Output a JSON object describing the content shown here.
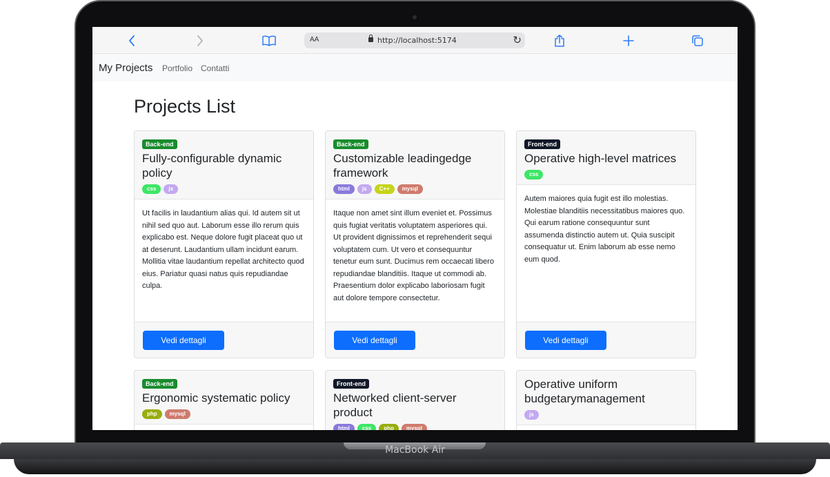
{
  "device": {
    "label": "MacBook Air"
  },
  "browser": {
    "text_size_label": "AA",
    "url": "http://localhost:5174"
  },
  "navbar": {
    "brand": "My Projects",
    "links": [
      "Portfolio",
      "Contatti"
    ]
  },
  "page": {
    "title": "Projects List"
  },
  "colors": {
    "backend_badge": "#198c2e",
    "frontend_badge": "#111827",
    "button": "#0d6efd",
    "tag_css": "#3ee667",
    "tag_js": "#c3a9f0",
    "tag_html": "#8a79dc",
    "tag_cpp": "#c6d41a",
    "tag_mysql": "#cf7b6d",
    "tag_php": "#98ad0d"
  },
  "projects": [
    {
      "type": "Back-end",
      "title": "Fully-configurable dynamic policy",
      "tags": [
        "css",
        "js"
      ],
      "description": "Ut facilis in laudantium alias qui. Id autem sit ut nihil sed quo aut. Laborum esse illo rerum quis explicabo est. Neque dolore fugit placeat quo ut at deserunt. Laudantium ullam incidunt earum. Mollitia vitae laudantium repellat architecto quod eius. Pariatur quasi natus quis repudiandae culpa.",
      "button": "Vedi dettagli"
    },
    {
      "type": "Back-end",
      "title": "Customizable leadingedge framework",
      "tags": [
        "html",
        "js",
        "C++",
        "mysql"
      ],
      "description": "Itaque non amet sint illum eveniet et. Possimus quis fugiat veritatis voluptatem asperiores qui. Ut provident dignissimos et reprehenderit sequi voluptatem cum. Ut vero et consequuntur tenetur eum sunt. Ducimus rem occaecati libero repudiandae blanditiis. Itaque ut commodi ab. Praesentium dolor explicabo laboriosam fugit aut dolore tempore consectetur.",
      "button": "Vedi dettagli"
    },
    {
      "type": "Front-end",
      "title": "Operative high-level matrices",
      "tags": [
        "css"
      ],
      "description": "Autem maiores quia fugit est illo molestias. Molestiae blanditiis necessitatibus maiores quo. Qui earum ratione consequuntur sunt assumenda distinctio autem ut. Quia suscipit consequatur ut. Enim laborum ab esse nemo eum quod.",
      "button": "Vedi dettagli"
    },
    {
      "type": "Back-end",
      "title": "Ergonomic systematic policy",
      "tags": [
        "php",
        "mysql"
      ]
    },
    {
      "type": "Front-end",
      "title": "Networked client-server product",
      "tags": [
        "html",
        "css",
        "php",
        "mysql"
      ]
    },
    {
      "title": "Operative uniform budgetarymanagement",
      "tags": [
        "js"
      ]
    }
  ]
}
